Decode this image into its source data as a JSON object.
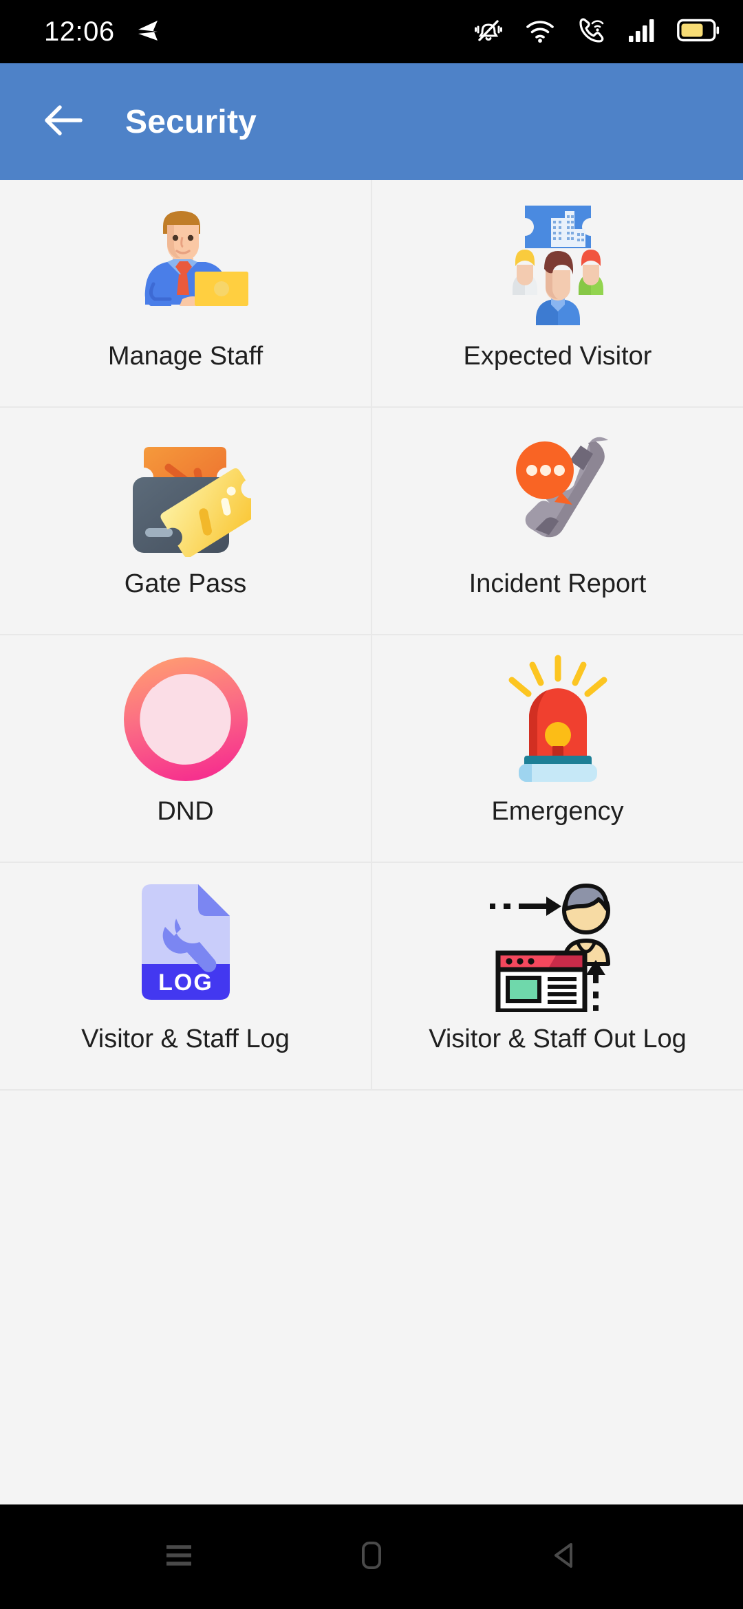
{
  "status_bar": {
    "time": "12:06",
    "left_icons": [
      "send-arrow-icon"
    ],
    "right_icons": [
      "vibrate-silent-icon",
      "wifi-icon",
      "vowifi-call-icon",
      "cellular-signal-icon",
      "battery-icon"
    ],
    "battery_fill_color": "#f7dc75",
    "background_color": "#000000",
    "text_color": "#ffffff"
  },
  "app_bar": {
    "title": "Security",
    "back_icon": "arrow-left-icon",
    "background_color": "#4e82c8",
    "title_color": "#ffffff"
  },
  "grid": {
    "columns": 2,
    "background_color": "#f4f4f4",
    "divider_color": "#e8e8e8",
    "label_color": "#1f1f1f",
    "items": [
      {
        "label": "Manage Staff",
        "icon": "manage-staff-icon"
      },
      {
        "label": "Expected Visitor",
        "icon": "expected-visitor-icon"
      },
      {
        "label": "Gate Pass",
        "icon": "gate-pass-icon"
      },
      {
        "label": "Incident Report",
        "icon": "incident-report-icon"
      },
      {
        "label": "DND",
        "icon": "dnd-icon"
      },
      {
        "label": "Emergency",
        "icon": "emergency-siren-icon"
      },
      {
        "label": "Visitor & Staff Log",
        "icon": "visitor-staff-log-icon"
      },
      {
        "label": "Visitor & Staff Out Log",
        "icon": "visitor-staff-out-log-icon"
      }
    ]
  },
  "nav_bar": {
    "background_color": "#000000",
    "icon_color": "#4a4a4a",
    "buttons": [
      {
        "name": "recents-button",
        "icon": "menu-lines-icon"
      },
      {
        "name": "home-button",
        "icon": "home-rounded-rect-icon"
      },
      {
        "name": "back-button",
        "icon": "back-triangle-icon"
      }
    ]
  }
}
